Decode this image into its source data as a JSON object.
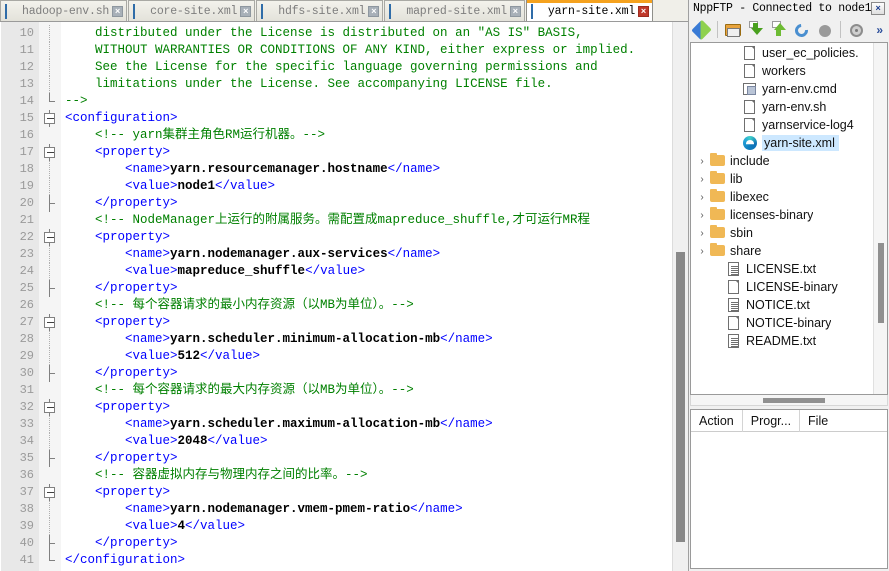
{
  "editor": {
    "tabs": [
      {
        "label": "hadoop-env.sh",
        "icon": "floppy-disk-icon",
        "active": false
      },
      {
        "label": "core-site.xml",
        "icon": "floppy-disk-icon",
        "active": false
      },
      {
        "label": "hdfs-site.xml",
        "icon": "floppy-disk-icon",
        "active": false
      },
      {
        "label": "mapred-site.xml",
        "icon": "floppy-disk-icon",
        "active": false
      },
      {
        "label": "yarn-site.xml",
        "icon": "floppy-disk-icon",
        "active": true
      }
    ],
    "close_glyph": "×",
    "first_line_number": 10,
    "lines": [
      {
        "n": 10,
        "fold": "dotted",
        "text": "    distributed under the License is distributed on an \"AS IS\" BASIS,",
        "kind": "cmt"
      },
      {
        "n": 11,
        "fold": "dotted",
        "text": "    WITHOUT WARRANTIES OR CONDITIONS OF ANY KIND, either express or implied.",
        "kind": "cmt"
      },
      {
        "n": 12,
        "fold": "dotted",
        "text": "    See the License for the specific language governing permissions and",
        "kind": "cmt"
      },
      {
        "n": 13,
        "fold": "dotted",
        "text": "    limitations under the License. See accompanying LICENSE file.",
        "kind": "cmt"
      },
      {
        "n": 14,
        "fold": "corner",
        "text": "-->",
        "kind": "cmt"
      },
      {
        "n": 15,
        "fold": "box",
        "text": "<configuration>",
        "kind": "tag"
      },
      {
        "n": 16,
        "fold": "none",
        "text": "    <!-- yarn集群主角色RM运行机器。-->",
        "kind": "cmt"
      },
      {
        "n": 17,
        "fold": "box",
        "text": "    <property>",
        "kind": "tag"
      },
      {
        "n": 18,
        "fold": "dotted",
        "text": "        <name>yarn.resourcemanager.hostname</name>",
        "kind": "mixed"
      },
      {
        "n": 19,
        "fold": "dotted",
        "text": "        <value>node1</value>",
        "kind": "mixed"
      },
      {
        "n": 20,
        "fold": "tee",
        "text": "    </property>",
        "kind": "tag"
      },
      {
        "n": 21,
        "fold": "none",
        "text": "    <!-- NodeManager上运行的附属服务。需配置成mapreduce_shuffle,才可运行MR程",
        "kind": "cmt"
      },
      {
        "n": 22,
        "fold": "box",
        "text": "    <property>",
        "kind": "tag"
      },
      {
        "n": 23,
        "fold": "dotted",
        "text": "        <name>yarn.nodemanager.aux-services</name>",
        "kind": "mixed"
      },
      {
        "n": 24,
        "fold": "dotted",
        "text": "        <value>mapreduce_shuffle</value>",
        "kind": "mixed"
      },
      {
        "n": 25,
        "fold": "tee",
        "text": "    </property>",
        "kind": "tag"
      },
      {
        "n": 26,
        "fold": "none",
        "text": "    <!-- 每个容器请求的最小内存资源（以MB为单位）。-->",
        "kind": "cmt"
      },
      {
        "n": 27,
        "fold": "box",
        "text": "    <property>",
        "kind": "tag"
      },
      {
        "n": 28,
        "fold": "dotted",
        "text": "        <name>yarn.scheduler.minimum-allocation-mb</name>",
        "kind": "mixed"
      },
      {
        "n": 29,
        "fold": "dotted",
        "text": "        <value>512</value>",
        "kind": "mixed"
      },
      {
        "n": 30,
        "fold": "tee",
        "text": "    </property>",
        "kind": "tag"
      },
      {
        "n": 31,
        "fold": "none",
        "text": "    <!-- 每个容器请求的最大内存资源（以MB为单位）。-->",
        "kind": "cmt"
      },
      {
        "n": 32,
        "fold": "box",
        "text": "    <property>",
        "kind": "tag"
      },
      {
        "n": 33,
        "fold": "dotted",
        "text": "        <name>yarn.scheduler.maximum-allocation-mb</name>",
        "kind": "mixed"
      },
      {
        "n": 34,
        "fold": "dotted",
        "text": "        <value>2048</value>",
        "kind": "mixed"
      },
      {
        "n": 35,
        "fold": "tee",
        "text": "    </property>",
        "kind": "tag"
      },
      {
        "n": 36,
        "fold": "none",
        "text": "    <!-- 容器虚拟内存与物理内存之间的比率。-->",
        "kind": "cmt"
      },
      {
        "n": 37,
        "fold": "box",
        "text": "    <property>",
        "kind": "tag"
      },
      {
        "n": 38,
        "fold": "dotted",
        "text": "        <name>yarn.nodemanager.vmem-pmem-ratio</name>",
        "kind": "mixed"
      },
      {
        "n": 39,
        "fold": "dotted",
        "text": "        <value>4</value>",
        "kind": "mixed"
      },
      {
        "n": 40,
        "fold": "tee",
        "text": "    </property>",
        "kind": "tag"
      },
      {
        "n": 41,
        "fold": "corner",
        "text": "</configuration>",
        "kind": "tag"
      }
    ]
  },
  "ftp": {
    "title": "NppFTP - Connected to node1",
    "close_glyph": "×",
    "toolbar": [
      {
        "name": "connect-icon",
        "glyph": "plug"
      },
      {
        "name": "separator",
        "glyph": "sep"
      },
      {
        "name": "open-folder-icon",
        "glyph": "folder"
      },
      {
        "name": "download-icon",
        "glyph": "down"
      },
      {
        "name": "upload-icon",
        "glyph": "up"
      },
      {
        "name": "refresh-icon",
        "glyph": "refresh"
      },
      {
        "name": "abort-icon",
        "glyph": "abort"
      },
      {
        "name": "separator",
        "glyph": "sep"
      },
      {
        "name": "settings-icon",
        "glyph": "gear"
      }
    ],
    "overflow_glyph": "»",
    "tree": [
      {
        "label": "user_ec_policies.",
        "icon": "file-icon",
        "expander": "",
        "indent": 2,
        "selected": false
      },
      {
        "label": "workers",
        "icon": "file-icon",
        "expander": "",
        "indent": 2,
        "selected": false
      },
      {
        "label": "yarn-env.cmd",
        "icon": "cmd-icon",
        "expander": "",
        "indent": 2,
        "selected": false
      },
      {
        "label": "yarn-env.sh",
        "icon": "file-icon",
        "expander": "",
        "indent": 2,
        "selected": false
      },
      {
        "label": "yarnservice-log4",
        "icon": "file-icon",
        "expander": "",
        "indent": 2,
        "selected": false
      },
      {
        "label": "yarn-site.xml",
        "icon": "edge-icon",
        "expander": "",
        "indent": 2,
        "selected": true
      },
      {
        "label": "include",
        "icon": "folder-icon",
        "expander": "›",
        "indent": 0,
        "selected": false
      },
      {
        "label": "lib",
        "icon": "folder-icon",
        "expander": "›",
        "indent": 0,
        "selected": false
      },
      {
        "label": "libexec",
        "icon": "folder-icon",
        "expander": "›",
        "indent": 0,
        "selected": false
      },
      {
        "label": "licenses-binary",
        "icon": "folder-icon",
        "expander": "›",
        "indent": 0,
        "selected": false
      },
      {
        "label": "sbin",
        "icon": "folder-icon",
        "expander": "›",
        "indent": 0,
        "selected": false
      },
      {
        "label": "share",
        "icon": "folder-icon",
        "expander": "›",
        "indent": 0,
        "selected": false
      },
      {
        "label": "LICENSE.txt",
        "icon": "textfile-icon",
        "expander": "",
        "indent": 1,
        "selected": false
      },
      {
        "label": "LICENSE-binary",
        "icon": "file-icon",
        "expander": "",
        "indent": 1,
        "selected": false
      },
      {
        "label": "NOTICE.txt",
        "icon": "textfile-icon",
        "expander": "",
        "indent": 1,
        "selected": false
      },
      {
        "label": "NOTICE-binary",
        "icon": "file-icon",
        "expander": "",
        "indent": 1,
        "selected": false
      },
      {
        "label": "README.txt",
        "icon": "textfile-icon",
        "expander": "",
        "indent": 1,
        "selected": false
      }
    ],
    "queue_columns": [
      "Action",
      "Progr...",
      "File"
    ]
  },
  "colors": {
    "accent_tab": "#f5a21e",
    "comment": "#008000",
    "tag": "#0000ff",
    "annotation_box": "#f5171f",
    "selection": "#cde8ff"
  }
}
